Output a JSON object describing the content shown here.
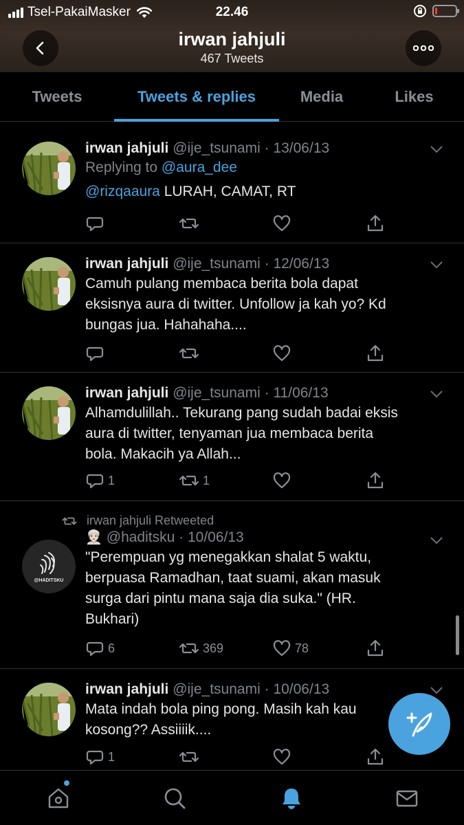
{
  "status_bar": {
    "carrier": "Tsel-PakaiMasker",
    "time": "22.46",
    "battery_level_pct": 12
  },
  "header": {
    "name": "irwan jahjuli",
    "tweet_count": "467 Tweets",
    "back_icon": "chevron-left-icon",
    "more_icon": "more-horizontal-icon"
  },
  "tabs": [
    {
      "label": "Tweets",
      "active": false
    },
    {
      "label": "Tweets & replies",
      "active": true
    },
    {
      "label": "Media",
      "active": false
    },
    {
      "label": "Likes",
      "active": false
    }
  ],
  "tweets": [
    {
      "name": "irwan jahjuli",
      "handle": "@ije_tsunami",
      "sep": "·",
      "date": "13/06/13",
      "replying_prefix": "Replying to ",
      "replying_to": "@aura_dee",
      "mention": "@rizqaaura",
      "text": " LURAH, CAMAT, RT",
      "reply_count": "",
      "retweet_count": "",
      "like_count": ""
    },
    {
      "name": "irwan jahjuli",
      "handle": "@ije_tsunami",
      "sep": "·",
      "date": "12/06/13",
      "text_lines": [
        "Camuh pulang membaca berita bola dapat",
        "eksisnya aura di twitter. Unfollow ja kah yo? Kd",
        "bungas jua. Hahahaha...."
      ],
      "reply_count": "",
      "retweet_count": "",
      "like_count": ""
    },
    {
      "name": "irwan jahjuli",
      "handle": "@ije_tsunami",
      "sep": "·",
      "date": "11/06/13",
      "text_lines": [
        "Alhamdulillah.. Tekurang pang sudah badai eksis",
        "aura di twitter, tenyaman jua membaca berita",
        "bola. Makacih ya Allah..."
      ],
      "reply_count": "1",
      "retweet_count": "1",
      "like_count": ""
    },
    {
      "retweeted_by": "irwan jahjuli Retweeted",
      "emoji": "👳🏻",
      "handle": "@haditsku",
      "sep": "·",
      "date": "10/06/13",
      "avatar_label": "@HADITSKU",
      "text_lines": [
        "\"Perempuan yg menegakkan shalat 5 waktu,",
        "berpuasa Ramadhan, taat suami, akan masuk",
        "surga dari pintu mana saja dia suka.\" (HR.",
        "Bukhari)"
      ],
      "reply_count": "6",
      "retweet_count": "369",
      "like_count": "78"
    },
    {
      "name": "irwan jahjuli",
      "handle": "@ije_tsunami",
      "sep": "·",
      "date": "10/06/13",
      "text_lines": [
        "Mata indah bola ping pong. Masih kah kau",
        "kosong?? Assiiiik...."
      ],
      "reply_count": "1",
      "retweet_count": "",
      "like_count": ""
    }
  ],
  "bottom_nav": [
    "home-icon",
    "search-icon",
    "notifications-icon",
    "messages-icon"
  ],
  "colors": {
    "accent": "#4aa3df",
    "background": "#000000",
    "muted": "#7f858b"
  }
}
